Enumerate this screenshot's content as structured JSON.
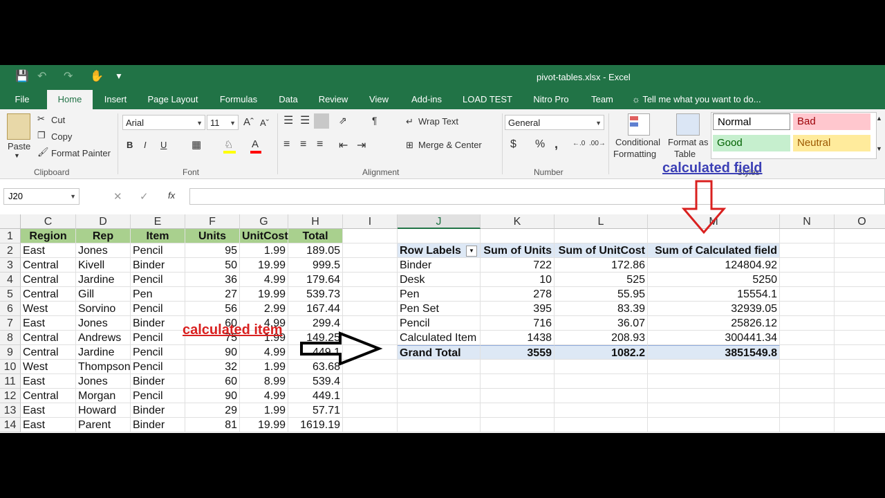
{
  "app": {
    "title": "pivot-tables.xlsx - Excel",
    "tabs": [
      "File",
      "Home",
      "Insert",
      "Page Layout",
      "Formulas",
      "Data",
      "Review",
      "View",
      "Add-ins",
      "LOAD TEST",
      "Nitro Pro",
      "Team"
    ],
    "tell_me": "Tell me what you want to do..."
  },
  "ribbon": {
    "clipboard": {
      "paste": "Paste",
      "cut": "Cut",
      "copy": "Copy",
      "format_painter": "Format Painter",
      "label": "Clipboard"
    },
    "font": {
      "name": "Arial",
      "size": "11",
      "bold": "B",
      "italic": "I",
      "underline": "U",
      "label": "Font"
    },
    "alignment": {
      "wrap": "Wrap Text",
      "merge": "Merge & Center",
      "label": "Alignment"
    },
    "number": {
      "format": "General",
      "currency": "$",
      "percent": "%",
      "comma": ",",
      "label": "Number"
    },
    "styles": {
      "conditional": "Conditional",
      "formatting": "Formatting",
      "format_as": "Format as",
      "table": "Table",
      "normal": "Normal",
      "bad": "Bad",
      "good": "Good",
      "neutral": "Neutral",
      "label": "Styles"
    }
  },
  "formula_bar": {
    "name_box": "J20",
    "fx": "fx",
    "content": ""
  },
  "grid": {
    "columns": [
      "C",
      "D",
      "E",
      "F",
      "G",
      "H",
      "I",
      "J",
      "K",
      "L",
      "M",
      "N",
      "O"
    ],
    "rows": [
      "1",
      "2",
      "3",
      "4",
      "5",
      "6",
      "7",
      "8",
      "9",
      "10",
      "11",
      "12",
      "13",
      "14"
    ],
    "table_headers": [
      "Region",
      "Rep",
      "Item",
      "Units",
      "UnitCost",
      "Total"
    ],
    "table_rows": [
      [
        "East",
        "Jones",
        "Pencil",
        "95",
        "1.99",
        "189.05"
      ],
      [
        "Central",
        "Kivell",
        "Binder",
        "50",
        "19.99",
        "999.5"
      ],
      [
        "Central",
        "Jardine",
        "Pencil",
        "36",
        "4.99",
        "179.64"
      ],
      [
        "Central",
        "Gill",
        "Pen",
        "27",
        "19.99",
        "539.73"
      ],
      [
        "West",
        "Sorvino",
        "Pencil",
        "56",
        "2.99",
        "167.44"
      ],
      [
        "East",
        "Jones",
        "Binder",
        "60",
        "4.99",
        "299.4"
      ],
      [
        "Central",
        "Andrews",
        "Pencil",
        "75",
        "1.99",
        "149.25"
      ],
      [
        "Central",
        "Jardine",
        "Pencil",
        "90",
        "4.99",
        "449.1"
      ],
      [
        "West",
        "Thompson",
        "Pencil",
        "32",
        "1.99",
        "63.68"
      ],
      [
        "East",
        "Jones",
        "Binder",
        "60",
        "8.99",
        "539.4"
      ],
      [
        "Central",
        "Morgan",
        "Pencil",
        "90",
        "4.99",
        "449.1"
      ],
      [
        "East",
        "Howard",
        "Binder",
        "29",
        "1.99",
        "57.71"
      ],
      [
        "East",
        "Parent",
        "Binder",
        "81",
        "19.99",
        "1619.19"
      ]
    ],
    "pivot_headers": [
      "Row Labels",
      "Sum of Units",
      "Sum of UnitCost",
      "Sum of Calculated field"
    ],
    "pivot_rows": [
      [
        "Binder",
        "722",
        "172.86",
        "124804.92"
      ],
      [
        "Desk",
        "10",
        "525",
        "5250"
      ],
      [
        "Pen",
        "278",
        "55.95",
        "15554.1"
      ],
      [
        "Pen Set",
        "395",
        "83.39",
        "32939.05"
      ],
      [
        "Pencil",
        "716",
        "36.07",
        "25826.12"
      ],
      [
        "Calculated Item",
        "1438",
        "208.93",
        "300441.34"
      ]
    ],
    "pivot_total": [
      "Grand Total",
      "3559",
      "1082.2",
      "3851549.8"
    ]
  },
  "annotations": {
    "calc_field": "calculated field",
    "calc_item": "calculated item",
    "field_color": "#3b3fb5",
    "item_color": "#d9201f"
  },
  "colors": {
    "excel_green": "#217346",
    "table_header": "#a9d08e",
    "pivot_header": "#dde8f5"
  }
}
